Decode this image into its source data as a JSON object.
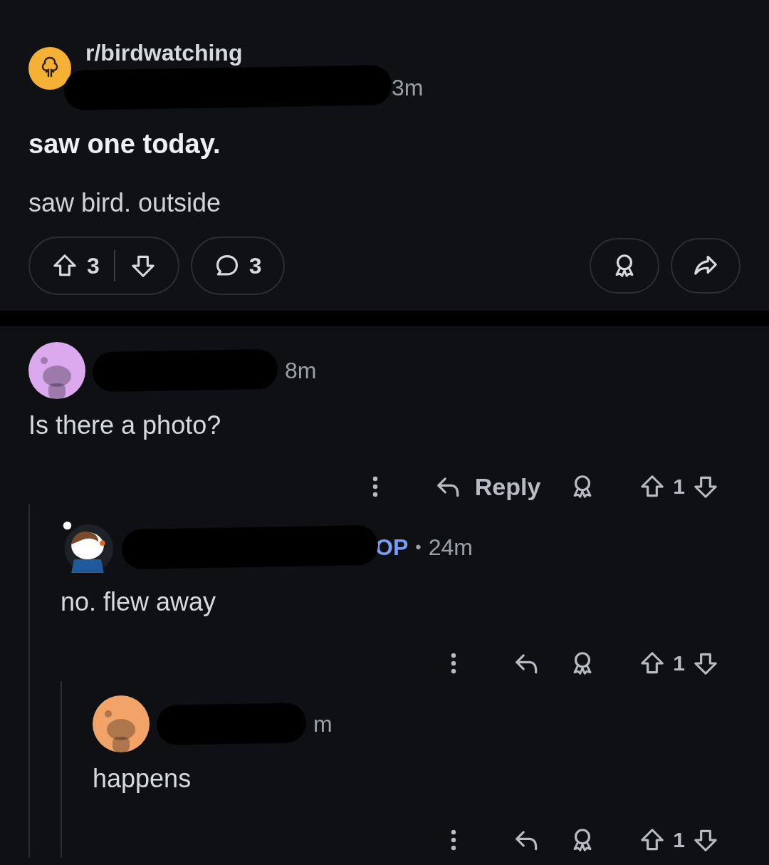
{
  "post": {
    "community": "r/birdwatching",
    "author_redacted": true,
    "time": "3m",
    "title": "saw one today.",
    "body": "saw bird. outside",
    "votes": "3",
    "comments": "3"
  },
  "comments": [
    {
      "avatar": {
        "kind": "snoo",
        "color": "#dca8ee"
      },
      "author_redacted": true,
      "time": "8m",
      "text": "Is there a photo?",
      "reply_label": "Reply",
      "votes": "1",
      "children": [
        {
          "avatar": {
            "kind": "character"
          },
          "author_redacted": true,
          "flair": "OP",
          "separator": "•",
          "time": "24m",
          "text": "no. flew away",
          "votes": "1",
          "children": [
            {
              "avatar": {
                "kind": "snoo",
                "color": "#f2a468"
              },
              "author_redacted": true,
              "time": "m",
              "text": "happens",
              "votes": "1"
            }
          ]
        }
      ]
    }
  ]
}
